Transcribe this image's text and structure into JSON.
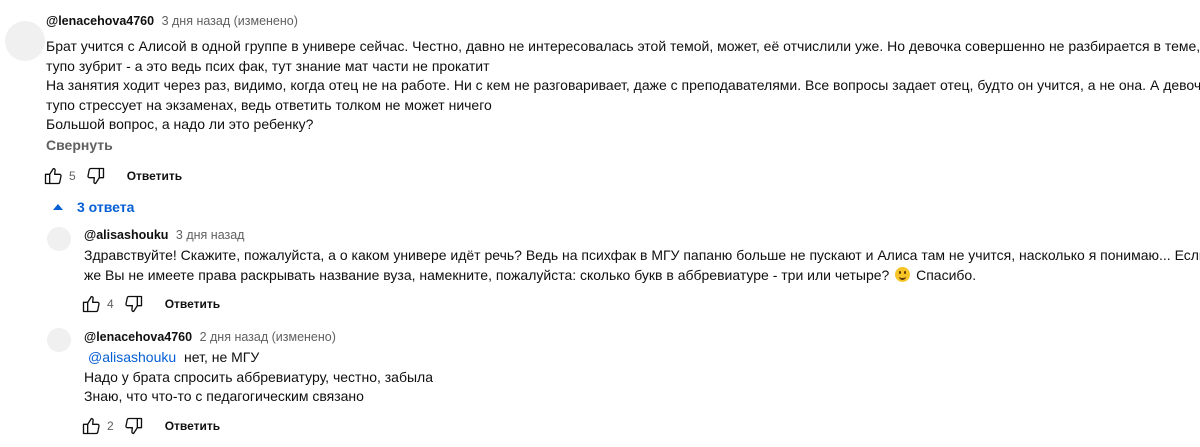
{
  "comment": {
    "author": "@lenacehova4760",
    "meta": "3 дня назад (изменено)",
    "lines": [
      "Брат учится с Алисой в одной группе в универе сейчас. Честно, давно не интересовалась этой темой, может, её отчислили уже. Но девочка совершенно не разбирается в теме,",
      "тупо зубрит - а это ведь псих фак, тут знание мат части не прокатит",
      "На занятия ходит через раз, видимо, когда отец не на работе. Ни с кем не разговаривает, даже с преподавателями. Все вопросы задает отец, будто он учится, а не она. А девочка",
      "тупо стрессует на экзаменах, ведь ответить толком не может ничего",
      "Большой вопрос, а надо ли это ребенку?"
    ],
    "collapse_label": "Свернуть",
    "likes": "5",
    "reply_label": "Ответить",
    "like_icon": "thumbs-up-icon",
    "dislike_icon": "thumbs-down-icon"
  },
  "replies_toggle": {
    "label": "3 ответа",
    "icon": "caret-up-icon"
  },
  "replies": [
    {
      "author": "@alisashouku",
      "meta": "3 дня назад",
      "lines": [
        "Здравствуйте! Скажите, пожалуйста, а о каком универе идёт речь? Ведь на психфак в МГУ папаню больше не пускают и Алиса там не учится, насколько я понимаю... Если",
        "же Вы не имеете права раскрывать название вуза, намекните, пожалуйста: сколько букв в аббревиатуре - три или четыре?"
      ],
      "line2_suffix": "Спасибо.",
      "emoji": "smiling-face-emoji",
      "likes": "4",
      "reply_label": "Ответить"
    },
    {
      "author": "@lenacehova4760",
      "meta": "2 дня назад (изменено)",
      "mention": "@alisashouku",
      "first_line_text": "нет, не МГУ",
      "lines": [
        "Надо у брата спросить аббревиатуру, честно, забыла",
        "Знаю, что что-то с педагогическим связано"
      ],
      "likes": "2",
      "reply_label": "Ответить"
    }
  ]
}
